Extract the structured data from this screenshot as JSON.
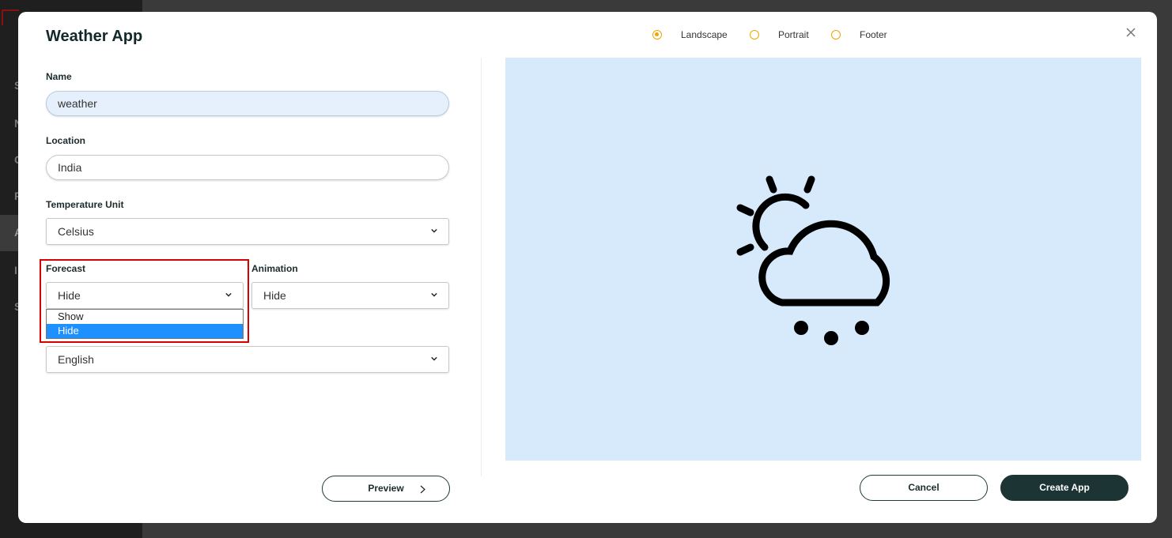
{
  "modal": {
    "title": "Weather App",
    "close_icon": "close-icon"
  },
  "orientation": {
    "options": [
      {
        "label": "Landscape",
        "checked": true
      },
      {
        "label": "Portrait",
        "checked": false
      },
      {
        "label": "Footer",
        "checked": false
      }
    ],
    "accent_color": "#f0a500"
  },
  "form": {
    "name_label": "Name",
    "name_value": "weather",
    "location_label": "Location",
    "location_value": "India",
    "temp_unit_label": "Temperature Unit",
    "temp_unit_value": "Celsius",
    "forecast_label": "Forecast",
    "forecast_value": "Hide",
    "forecast_options": [
      "Show",
      "Hide"
    ],
    "forecast_selected_option": "Hide",
    "animation_label": "Animation",
    "animation_value": "Hide",
    "language_value": "English"
  },
  "preview": {
    "background": "#d6eafc",
    "icon": "cloud-sun-snow-icon"
  },
  "buttons": {
    "preview": "Preview",
    "cancel": "Cancel",
    "create": "Create App"
  },
  "colors": {
    "dark_button": "#1c3434",
    "highlight": "#d90000",
    "option_selected": "#1e90ff"
  }
}
